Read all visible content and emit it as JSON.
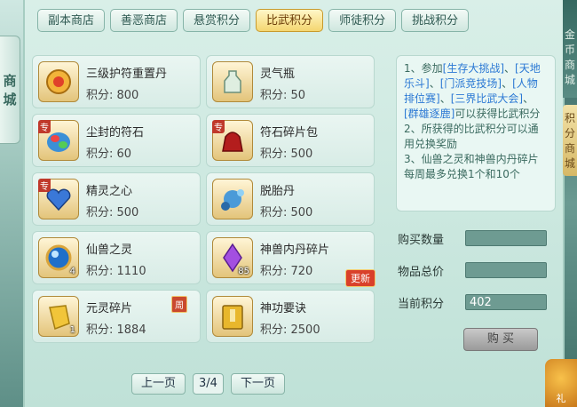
{
  "side": {
    "left_tab": [
      "商",
      "城"
    ],
    "right_tab": [
      "金",
      "币",
      "商",
      "城"
    ],
    "right_tab2": [
      "积",
      "分",
      "商",
      "城"
    ]
  },
  "tabs": [
    {
      "label": "副本商店",
      "active": false
    },
    {
      "label": "善恶商店",
      "active": false
    },
    {
      "label": "悬赏积分",
      "active": false
    },
    {
      "label": "比武积分",
      "active": true
    },
    {
      "label": "师徒积分",
      "active": false
    },
    {
      "label": "挑战积分",
      "active": false
    }
  ],
  "items": [
    {
      "name": "三级护符重置丹",
      "price": "积分: 800",
      "icon": "gold-charm-pill-icon",
      "zhuan": false,
      "qty": ""
    },
    {
      "name": "灵气瓶",
      "price": "积分: 50",
      "icon": "jade-bottle-icon",
      "zhuan": false,
      "qty": ""
    },
    {
      "name": "尘封的符石",
      "price": "积分: 60",
      "icon": "rune-stone-icon",
      "zhuan": true,
      "qty": ""
    },
    {
      "name": "符石碎片包",
      "price": "积分: 500",
      "icon": "fragment-bag-icon",
      "zhuan": true,
      "qty": ""
    },
    {
      "name": "精灵之心",
      "price": "积分: 500",
      "icon": "spirit-heart-icon",
      "zhuan": true,
      "qty": ""
    },
    {
      "name": "脱胎丹",
      "price": "积分: 500",
      "icon": "rebirth-pill-icon",
      "zhuan": false,
      "qty": ""
    },
    {
      "name": "仙兽之灵",
      "price": "积分: 1110",
      "icon": "beast-spirit-orb-icon",
      "zhuan": false,
      "qty": "4"
    },
    {
      "name": "神兽内丹碎片",
      "price": "积分: 720",
      "icon": "crystal-shard-icon",
      "zhuan": false,
      "qty": "85",
      "badge": "更新"
    },
    {
      "name": "元灵碎片",
      "price": "积分: 1884",
      "icon": "gold-shard-icon",
      "zhuan": false,
      "qty": "1",
      "week": "周"
    },
    {
      "name": "神功要诀",
      "price": "积分: 2500",
      "icon": "skill-book-icon",
      "zhuan": false,
      "qty": ""
    }
  ],
  "zhuan_label": "专",
  "pager": {
    "prev": "上一页",
    "page": "3/4",
    "next": "下一页"
  },
  "info_text": [
    {
      "t": "1、参加",
      "c": ""
    },
    {
      "t": "[生存大挑战]",
      "c": "blue"
    },
    {
      "t": "、",
      "c": ""
    },
    {
      "t": "[天地乐斗]",
      "c": "blue"
    },
    {
      "t": "、",
      "c": ""
    },
    {
      "t": "[门派竞技场]",
      "c": "blue"
    },
    {
      "t": "、",
      "c": ""
    },
    {
      "t": "[人物排位赛]",
      "c": "blue"
    },
    {
      "t": "、",
      "c": ""
    },
    {
      "t": "[三界比武大会]",
      "c": "blue"
    },
    {
      "t": "、",
      "c": ""
    },
    {
      "t": "[群雄逐鹿]",
      "c": "blue"
    },
    {
      "t": "可以获得比武积分",
      "c": ""
    },
    {
      "t": "\n2、所获得的比武积分可以通用兑换奖励",
      "c": ""
    },
    {
      "t": "\n3、仙兽之灵和神兽内丹碎片每周最多兑换1个和10个",
      "c": ""
    }
  ],
  "form": {
    "qty_label": "购买数量",
    "qty_value": "",
    "total_label": "物品总价",
    "total_value": "",
    "points_label": "当前积分",
    "points_value": "402"
  },
  "buy_label": "购 买",
  "gift_label": "礼"
}
